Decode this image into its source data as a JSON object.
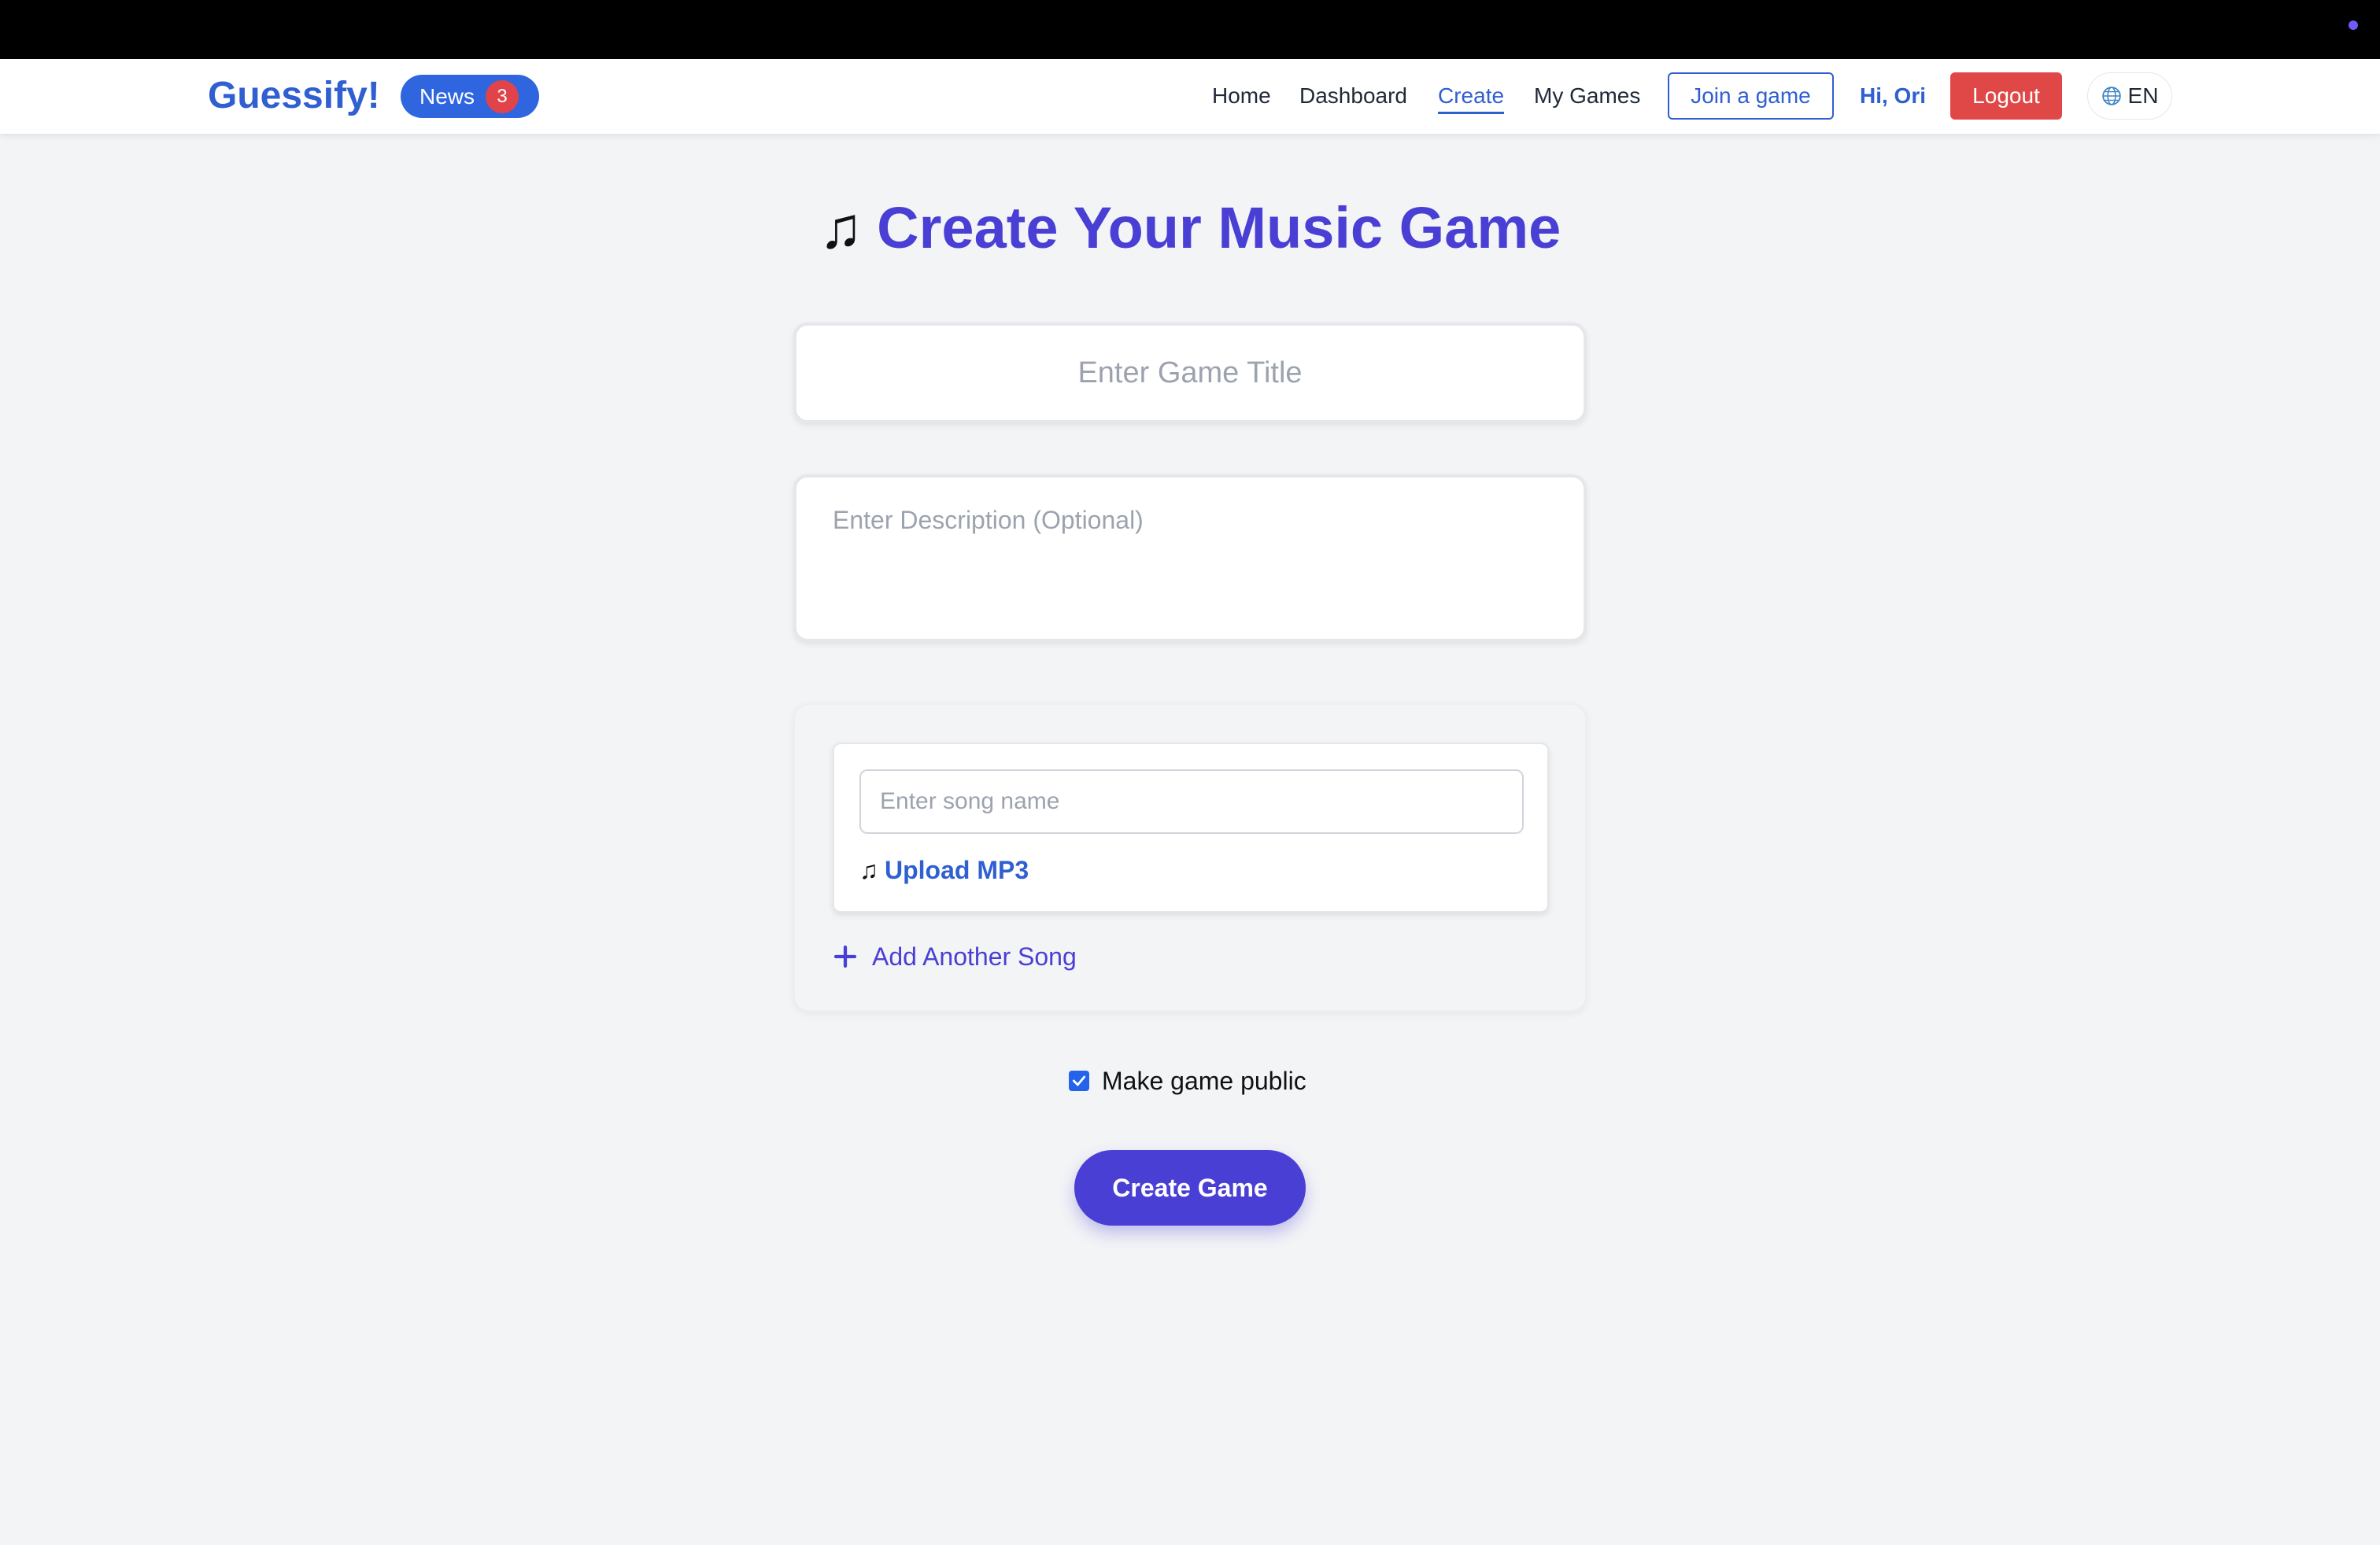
{
  "header": {
    "logo": "Guessify!",
    "news_label": "News",
    "news_count": "3",
    "nav": [
      {
        "label": "Home",
        "active": false
      },
      {
        "label": "Dashboard",
        "active": false
      },
      {
        "label": "Create",
        "active": true
      },
      {
        "label": "My Games",
        "active": false
      }
    ],
    "join_label": "Join a game",
    "greeting": "Hi, Ori",
    "logout_label": "Logout",
    "language": "EN"
  },
  "page": {
    "title_icon": "♫",
    "title": "Create Your Music Game",
    "game_title_placeholder": "Enter Game Title",
    "description_placeholder": "Enter Description (Optional)"
  },
  "songs": {
    "song_name_placeholder": "Enter song name",
    "upload_icon": "♫",
    "upload_label": "Upload MP3",
    "add_song_label": "Add Another Song"
  },
  "options": {
    "public_label": "Make game public",
    "public_checked": true
  },
  "submit": {
    "create_label": "Create Game"
  },
  "colors": {
    "brand_blue": "#2f5fd0",
    "accent_purple": "#4a3fd4",
    "danger_red": "#e04848",
    "background": "#f3f4f6"
  }
}
